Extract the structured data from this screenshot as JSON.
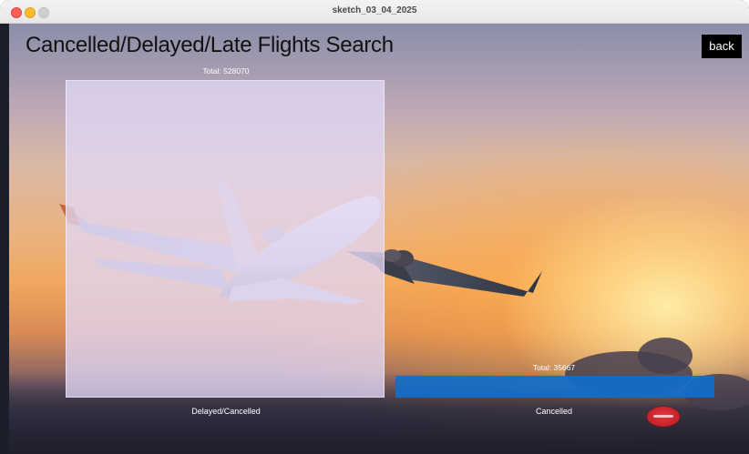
{
  "window": {
    "title": "sketch_03_04_2025"
  },
  "app": {
    "title": "Cancelled/Delayed/Late Flights Search",
    "back_label": "back"
  },
  "bars": {
    "delayed": {
      "label": "Delayed/Cancelled",
      "total_text": "Total: 528070",
      "total": 528070
    },
    "cancelled": {
      "label": "Cancelled",
      "total_text": "Total: 35667",
      "total": 35667
    }
  },
  "colors": {
    "delayed_bar": "#e1d7f5",
    "cancelled_bar": "#126ecd",
    "back_button": "#000000"
  },
  "icons": {
    "logo": "airline-logo-icon"
  }
}
